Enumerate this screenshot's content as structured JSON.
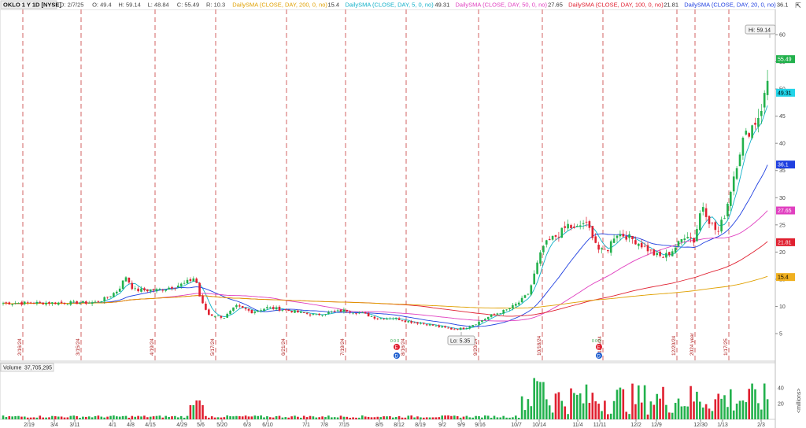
{
  "header": {
    "symbol_info": "OKLO 1 Y 1D [NYSE]",
    "ohlc": [
      {
        "label": "D: 2/7/25"
      },
      {
        "label": "O: 49.4"
      },
      {
        "label": "H: 59.14"
      },
      {
        "label": "L: 48.84"
      },
      {
        "label": "C: 55.49"
      },
      {
        "label": "R: 10.3"
      }
    ],
    "studies": [
      {
        "label": "DailySMA (CLOSE, DAY, 200, 0, no)",
        "value": "15.4",
        "color": "#e0a000"
      },
      {
        "label": "DailySMA (CLOSE, DAY, 5, 0, no)",
        "value": "49.31",
        "color": "#10b0c8"
      },
      {
        "label": "DailySMA (CLOSE, DAY, 50, 0, no)",
        "value": "27.65",
        "color": "#e040c0"
      },
      {
        "label": "DailySMA (CLOSE, DAY, 100, 0, no)",
        "value": "21.81",
        "color": "#e02030"
      },
      {
        "label": "DailySMA (CLOSE, DAY, 20, 0, no)",
        "value": "36.1",
        "color": "#2040e0"
      }
    ]
  },
  "price_axis": {
    "ticks": [
      "60",
      "55",
      "50",
      "45",
      "40",
      "35",
      "30",
      "25",
      "20",
      "15",
      "10",
      "5"
    ],
    "labels": [
      {
        "text": "55.49",
        "value": 55.49,
        "bg": "#22b14c",
        "fg": "#ffffff"
      },
      {
        "text": "49.31",
        "value": 49.31,
        "bg": "#22d4e8",
        "fg": "#000000"
      },
      {
        "text": "36.1",
        "value": 36.1,
        "bg": "#2040e0",
        "fg": "#ffffff"
      },
      {
        "text": "27.65",
        "value": 27.65,
        "bg": "#e040c0",
        "fg": "#ffffff"
      },
      {
        "text": "21.81",
        "value": 21.81,
        "bg": "#e02030",
        "fg": "#ffffff"
      },
      {
        "text": "15.4",
        "value": 15.4,
        "bg": "#f0b020",
        "fg": "#000000"
      }
    ],
    "hi_label": "Hi: 59.14",
    "lo_label": "Lo: 5.35"
  },
  "vertical_markers": [
    "2/16/24",
    "3/15/24",
    "4/19/24",
    "5/17/24",
    "6/21/24",
    "7/19/24",
    "8/16/24",
    "9/20/24",
    "10/18/24",
    "11/15/24",
    "12/20/24",
    "2024 year",
    "1/17/25"
  ],
  "volume": {
    "label": "Volume",
    "value": "37,705,295",
    "ticks": [
      "40",
      "20"
    ],
    "unit": "<millions>"
  },
  "x_axis": {
    "ticks": [
      "2/19",
      "3/4",
      "3/11",
      "4/1",
      "4/8",
      "4/15",
      "4/29",
      "5/6",
      "5/20",
      "6/3",
      "6/10",
      "7/1",
      "7/8",
      "7/15",
      "8/5",
      "8/12",
      "8/19",
      "9/2",
      "9/9",
      "9/16",
      "10/7",
      "10/14",
      "11/4",
      "11/11",
      "12/2",
      "12/9",
      "12/30",
      "1/13",
      "2/3"
    ]
  },
  "colors": {
    "up": "#22b14c",
    "down": "#e02030",
    "grid_marker": "#c83c3c"
  },
  "icons": {
    "corner": "collapse-icon",
    "event_e": "earnings-icon",
    "event_d": "dividend-icon"
  }
}
